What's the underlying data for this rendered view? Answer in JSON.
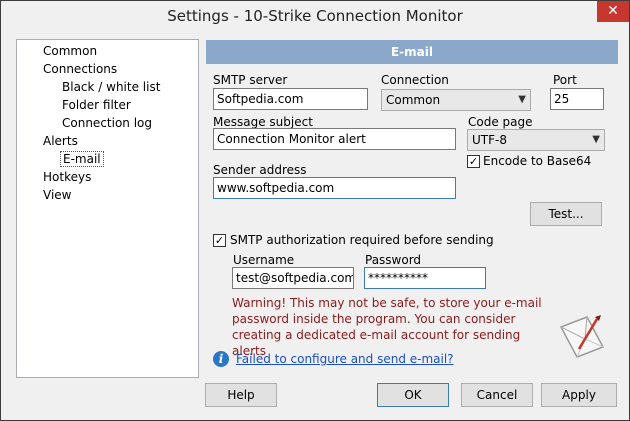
{
  "window": {
    "title": "Settings - 10-Strike Connection Monitor",
    "close_glyph": "✕"
  },
  "nav": {
    "items": [
      {
        "label": "Common"
      },
      {
        "label": "Connections"
      },
      {
        "label": "Black / white list"
      },
      {
        "label": "Folder filter"
      },
      {
        "label": "Connection log"
      },
      {
        "label": "Alerts"
      },
      {
        "label": "E-mail"
      },
      {
        "label": "Hotkeys"
      },
      {
        "label": "View"
      }
    ],
    "selected": "E-mail"
  },
  "panel": {
    "header": "E-mail"
  },
  "smtp": {
    "label": "SMTP server",
    "value": "Softpedia.com"
  },
  "connection": {
    "label": "Connection",
    "value": "Common"
  },
  "port": {
    "label": "Port",
    "value": "25"
  },
  "subject": {
    "label": "Message subject",
    "value": "Connection Monitor alert"
  },
  "codepage": {
    "label": "Code page",
    "value": "UTF-8"
  },
  "base64": {
    "label": "Encode to Base64",
    "checked": true
  },
  "sender": {
    "label": "Sender address",
    "value": "www.softpedia.com"
  },
  "test_button": "Test...",
  "auth": {
    "label": "SMTP authorization required before sending",
    "checked": true
  },
  "username": {
    "label": "Username",
    "value": "test@softpedia.com"
  },
  "password": {
    "label": "Password",
    "value": "**********"
  },
  "warning": "Warning! This may not be safe, to store your e-mail password inside the program. You can consider creating a dedicated e-mail account for sending alerts",
  "help_link": "Failed to configure and send e-mail?",
  "buttons": {
    "help": "Help",
    "ok": "OK",
    "cancel": "Cancel",
    "apply": "Apply"
  },
  "colors": {
    "header_bg": "#8ba7c9",
    "warning_text": "#8b1a1a",
    "link": "#1a4fc9",
    "close_bg": "#c7372f"
  }
}
